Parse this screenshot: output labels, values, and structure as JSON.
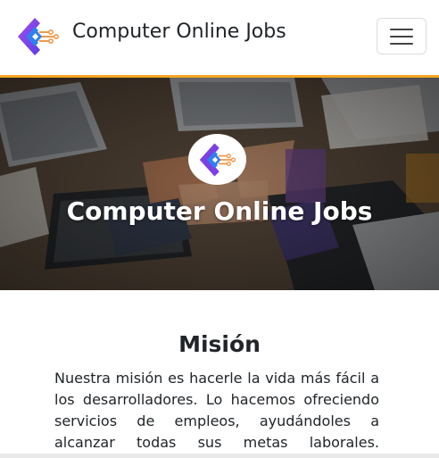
{
  "navbar": {
    "brand_name": "Computer Online Jobs",
    "logo_icon": "circuit-diamond-logo",
    "menu_icon": "hamburger-menu-icon",
    "accent_color": "#f5a623"
  },
  "hero": {
    "title": "Computer Online Jobs",
    "logo_icon": "circuit-diamond-logo"
  },
  "mission": {
    "title": "Misión",
    "text": "Nuestra misión es hacerle la vida más fácil a los desarrolladores. Lo hacemos ofreciendo servicios de empleos, ayudándoles a alcanzar todas sus metas laborales. Comprometidos a"
  },
  "colors": {
    "logo_purple": "#7b3fe4",
    "logo_blue": "#2f80ed",
    "logo_orange": "#f2994a"
  }
}
